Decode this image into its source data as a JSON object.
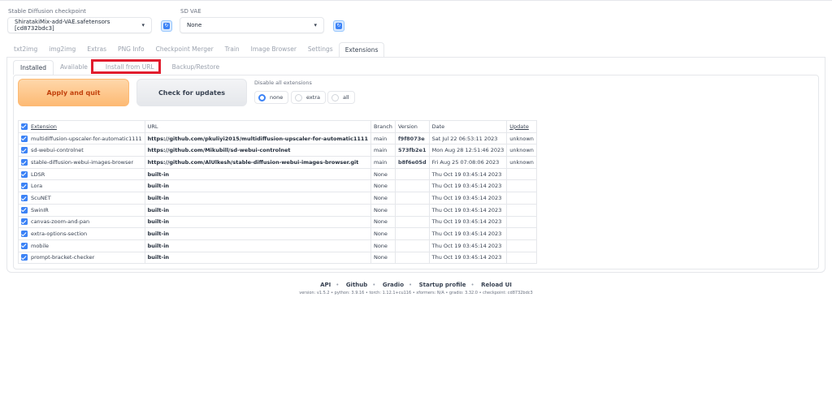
{
  "header": {
    "checkpoint_label": "Stable Diffusion checkpoint",
    "checkpoint_value": "ShiratakiMix-add-VAE.safetensors [cd8732bdc3]",
    "vae_label": "SD VAE",
    "vae_value": "None"
  },
  "tabs": [
    "txt2img",
    "img2img",
    "Extras",
    "PNG Info",
    "Checkpoint Merger",
    "Train",
    "Image Browser",
    "Settings",
    "Extensions"
  ],
  "subtabs": [
    "Installed",
    "Available",
    "Install from URL",
    "Backup/Restore"
  ],
  "buttons": {
    "apply": "Apply and quit",
    "check": "Check for updates"
  },
  "disable": {
    "label": "Disable all extensions",
    "options": [
      "none",
      "extra",
      "all"
    ],
    "selected": "none"
  },
  "table": {
    "headers": [
      "Extension",
      "URL",
      "Branch",
      "Version",
      "Date",
      "Update"
    ],
    "rows": [
      [
        "multidiffusion-upscaler-for-automatic1111",
        "https://github.com/pkuliyi2015/multidiffusion-upscaler-for-automatic1111",
        "main",
        "f9f8073e",
        "Sat Jul 22 06:53:11 2023",
        "unknown"
      ],
      [
        "sd-webui-controlnet",
        "https://github.com/Mikubill/sd-webui-controlnet",
        "main",
        "573fb2e1",
        "Mon Aug 28 12:51:46 2023",
        "unknown"
      ],
      [
        "stable-diffusion-webui-images-browser",
        "https://github.com/AlUlkesh/stable-diffusion-webui-images-browser.git",
        "main",
        "b8f6e05d",
        "Fri Aug 25 07:08:06 2023",
        "unknown"
      ],
      [
        "LDSR",
        "built-in",
        "None",
        "",
        "Thu Oct 19 03:45:14 2023",
        ""
      ],
      [
        "Lora",
        "built-in",
        "None",
        "",
        "Thu Oct 19 03:45:14 2023",
        ""
      ],
      [
        "ScuNET",
        "built-in",
        "None",
        "",
        "Thu Oct 19 03:45:14 2023",
        ""
      ],
      [
        "SwinIR",
        "built-in",
        "None",
        "",
        "Thu Oct 19 03:45:14 2023",
        ""
      ],
      [
        "canvas-zoom-and-pan",
        "built-in",
        "None",
        "",
        "Thu Oct 19 03:45:14 2023",
        ""
      ],
      [
        "extra-options-section",
        "built-in",
        "None",
        "",
        "Thu Oct 19 03:45:14 2023",
        ""
      ],
      [
        "mobile",
        "built-in",
        "None",
        "",
        "Thu Oct 19 03:45:14 2023",
        ""
      ],
      [
        "prompt-bracket-checker",
        "built-in",
        "None",
        "",
        "Thu Oct 19 03:45:14 2023",
        ""
      ]
    ]
  },
  "footer": {
    "links": [
      "API",
      "Github",
      "Gradio",
      "Startup profile",
      "Reload UI"
    ],
    "version_text": "version: v1.5.2  •  python: 3.9.16  •  torch: 1.12.1+cu116  •  xformers: N/A  •  gradio: 3.32.0  •  checkpoint: cd8732bdc3"
  },
  "colors": {
    "accent": "#3b82f6",
    "primary_button": "#fdba74",
    "highlight_box": "#e11d2e"
  }
}
